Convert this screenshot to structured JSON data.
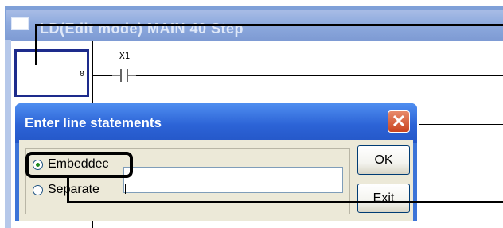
{
  "window": {
    "title": "LD(Edit mode)  MAIN  40 Step"
  },
  "ladder": {
    "step_number": "0",
    "contact_label": "X1"
  },
  "dialog": {
    "title": "Enter line statements",
    "close_glyph": "✕",
    "radios": [
      {
        "label": "Embeddec",
        "selected": true
      },
      {
        "label": "Separate",
        "selected": false
      }
    ],
    "input_value": "",
    "ok_label": "OK",
    "exit_label": "Exit"
  },
  "colors": {
    "dialog_title": "#2c63d6",
    "dialog_body": "#ece9d8",
    "cursor_box": "#1d2b8c",
    "window_frame": "#7fa0d8"
  }
}
